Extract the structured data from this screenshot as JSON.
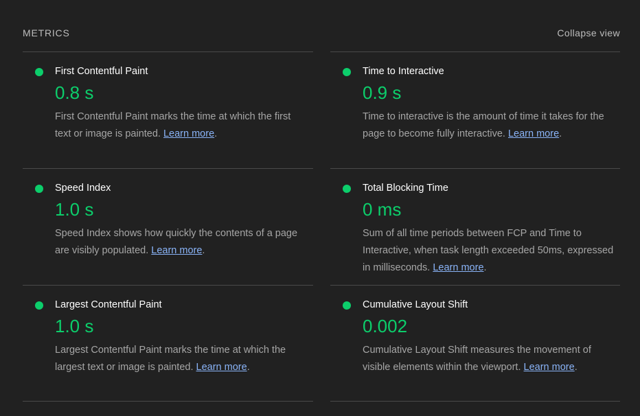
{
  "header": {
    "title": "METRICS",
    "collapse_label": "Collapse view"
  },
  "colors": {
    "pass": "#0cce6b",
    "link": "#8ab4f8"
  },
  "metrics": [
    {
      "title": "First Contentful Paint",
      "value": "0.8 s",
      "description": "First Contentful Paint marks the time at which the first text or image is painted.",
      "link": "Learn more",
      "status": "pass"
    },
    {
      "title": "Time to Interactive",
      "value": "0.9 s",
      "description": "Time to interactive is the amount of time it takes for the page to become fully interactive.",
      "link": "Learn more",
      "status": "pass"
    },
    {
      "title": "Speed Index",
      "value": "1.0 s",
      "description": "Speed Index shows how quickly the contents of a page are visibly populated.",
      "link": "Learn more",
      "status": "pass"
    },
    {
      "title": "Total Blocking Time",
      "value": "0 ms",
      "description": "Sum of all time periods between FCP and Time to Interactive, when task length exceeded 50ms, expressed in milliseconds.",
      "link": "Learn more",
      "status": "pass"
    },
    {
      "title": "Largest Contentful Paint",
      "value": "1.0 s",
      "description": "Largest Contentful Paint marks the time at which the largest text or image is painted.",
      "link": "Learn more",
      "status": "pass"
    },
    {
      "title": "Cumulative Layout Shift",
      "value": "0.002",
      "description": "Cumulative Layout Shift measures the movement of visible elements within the viewport.",
      "link": "Learn more",
      "status": "pass"
    }
  ]
}
